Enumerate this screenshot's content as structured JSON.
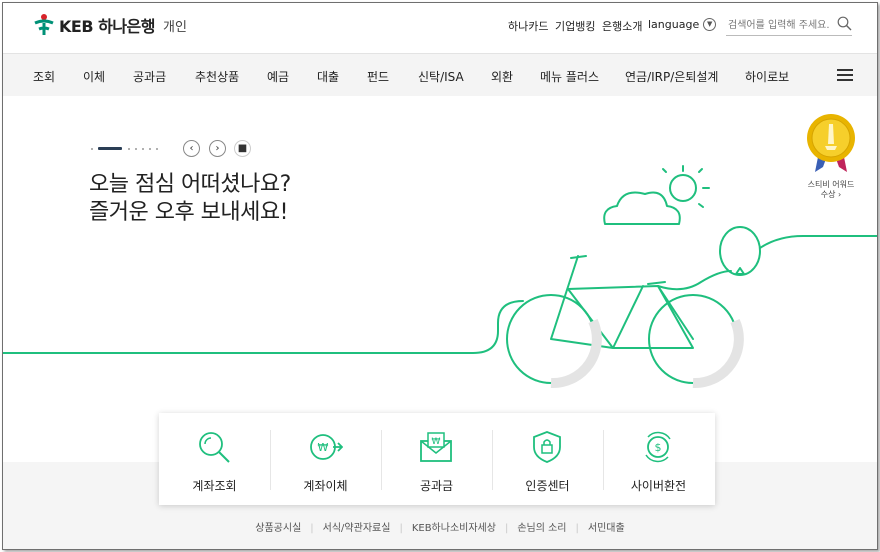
{
  "header": {
    "logo_text": "KEB 하나은행",
    "logo_sub": "개인",
    "util_links": [
      "하나카드",
      "기업뱅킹",
      "은행소개"
    ],
    "language_label": "language",
    "search_placeholder": "검색어를 입력해 주세요."
  },
  "nav": {
    "items": [
      "조회",
      "이체",
      "공과금",
      "추천상품",
      "예금",
      "대출",
      "펀드",
      "신탁/ISA",
      "외환",
      "메뉴 플러스",
      "연금/IRP/은퇴설계",
      "하이로보"
    ]
  },
  "hero": {
    "headline_line1": "오늘 점심 어떠셨나요?",
    "headline_line2": "즐거운 오후 보내세요!",
    "award_line1": "스티비 어워드",
    "award_line2": "수상 ›"
  },
  "quick_menu": {
    "items": [
      {
        "label": "계좌조회",
        "icon": "magnifier-icon"
      },
      {
        "label": "계좌이체",
        "icon": "won-transfer-icon"
      },
      {
        "label": "공과금",
        "icon": "won-envelope-icon"
      },
      {
        "label": "인증센터",
        "icon": "lock-icon"
      },
      {
        "label": "사이버환전",
        "icon": "dollar-exchange-icon"
      }
    ]
  },
  "footer": {
    "links": [
      "상품공시실",
      "서식/약관자료실",
      "KEB하나소비자세상",
      "손님의 소리",
      "서민대출"
    ]
  },
  "colors": {
    "accent_green": "#1fbf7e",
    "brand_red": "#d8232a",
    "brand_green": "#009177"
  }
}
